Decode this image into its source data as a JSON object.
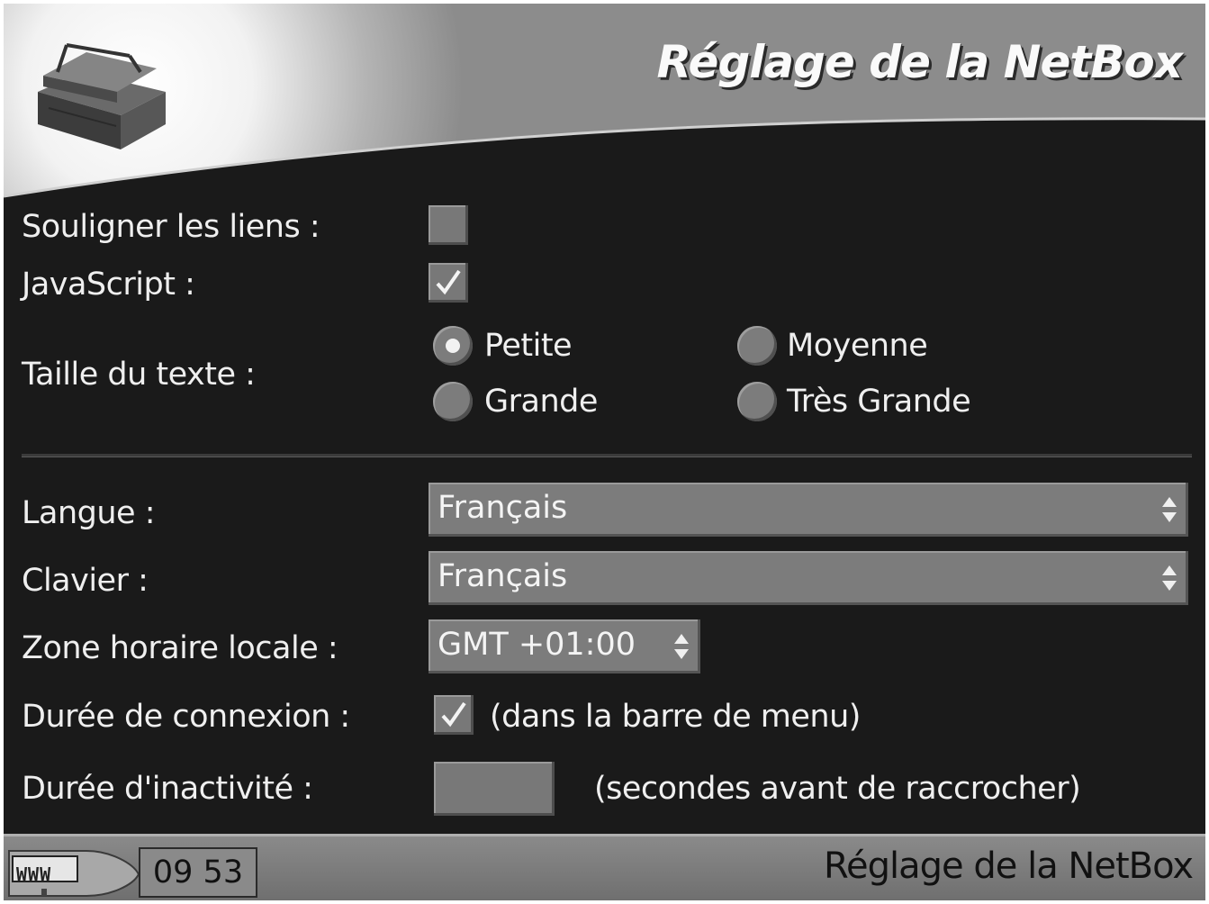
{
  "header": {
    "title": "Réglage de la NetBox",
    "logo": "toolbox-icon"
  },
  "form": {
    "underline_links": {
      "label": "Souligner les liens :",
      "checked": false
    },
    "javascript": {
      "label": "JavaScript :",
      "checked": true
    },
    "text_size": {
      "label": "Taille du texte :",
      "options": [
        "Petite",
        "Moyenne",
        "Grande",
        "Très Grande"
      ],
      "selected": "Petite"
    },
    "language": {
      "label": "Langue :",
      "value": "Français"
    },
    "keyboard": {
      "label": "Clavier :",
      "value": "Français"
    },
    "timezone": {
      "label": "Zone horaire locale :",
      "value": "GMT +01:00"
    },
    "connection_time": {
      "label": "Durée de connexion :",
      "checked": true,
      "hint": "(dans la barre de menu)"
    },
    "idle_time": {
      "label": "Durée d'inactivité :",
      "value": "",
      "hint": "(secondes avant de raccrocher)"
    }
  },
  "statusbar": {
    "www_label": "WWW",
    "clock": "09 53",
    "title": "Réglage de la NetBox"
  },
  "colors": {
    "background": "#1a1a1a",
    "control": "#7c7c7c",
    "statusbar": "#7e7e7e"
  }
}
